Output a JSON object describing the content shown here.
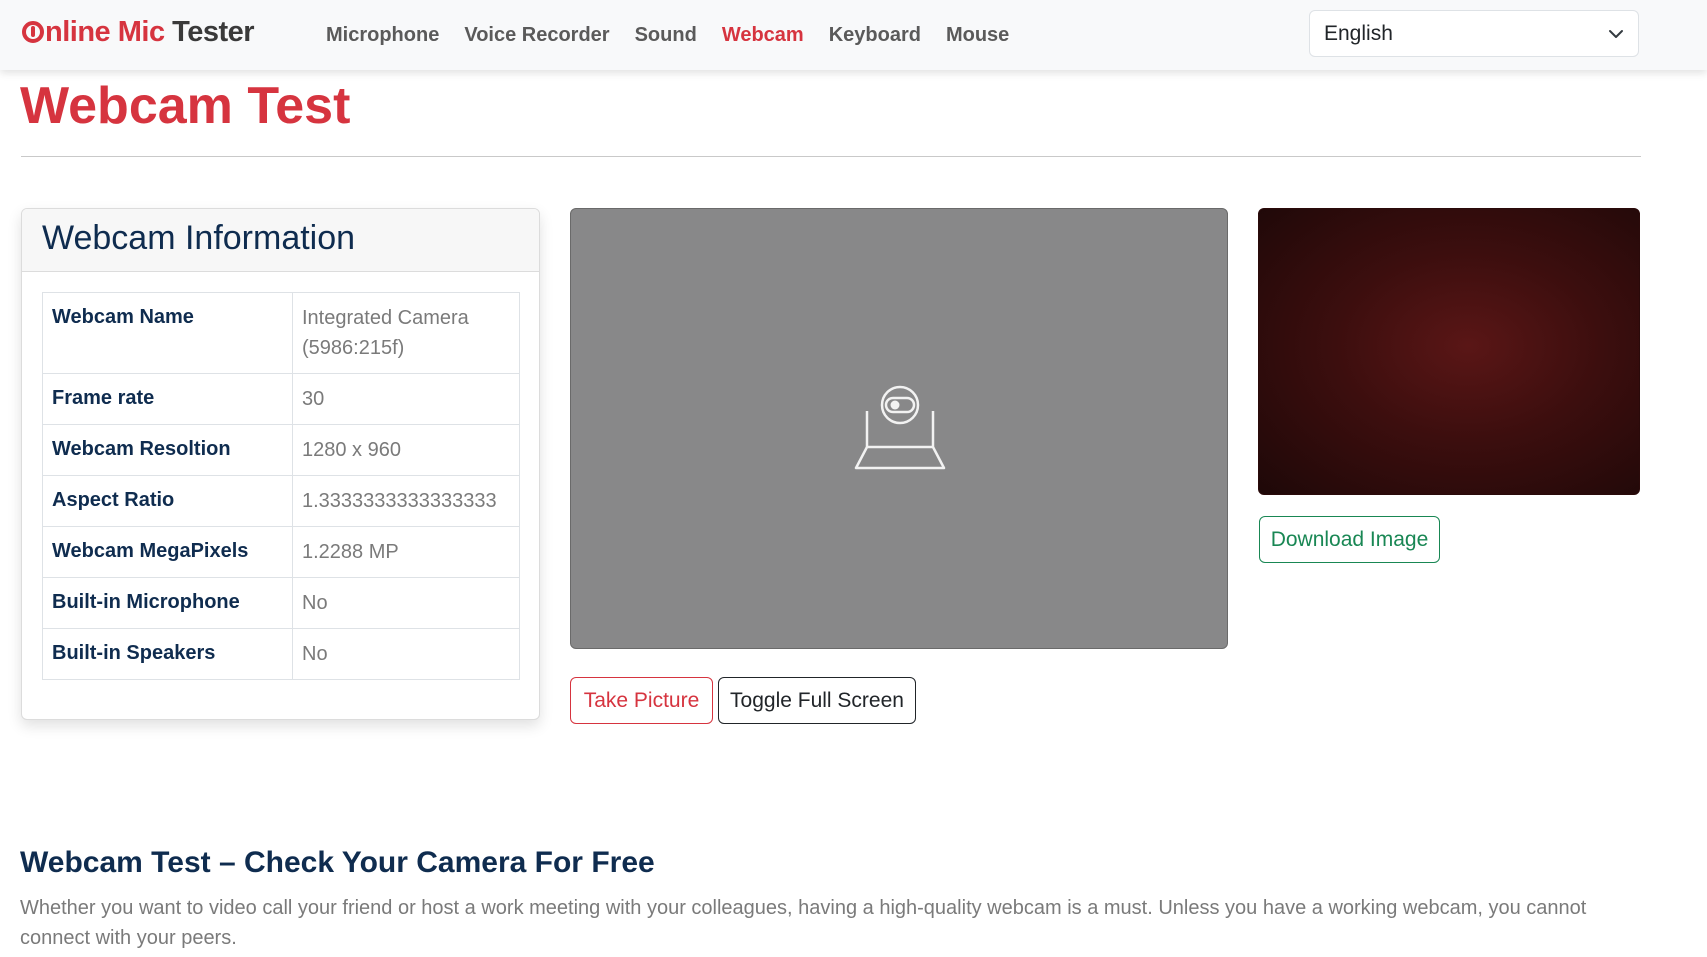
{
  "brand": {
    "logo_red": "nline Mic",
    "logo_dark": "Tester"
  },
  "nav": {
    "items": [
      {
        "label": "Microphone",
        "active": false
      },
      {
        "label": "Voice Recorder",
        "active": false
      },
      {
        "label": "Sound",
        "active": false
      },
      {
        "label": "Webcam",
        "active": true
      },
      {
        "label": "Keyboard",
        "active": false
      },
      {
        "label": "Mouse",
        "active": false
      }
    ],
    "language": "English"
  },
  "page": {
    "title": "Webcam Test"
  },
  "info": {
    "title": "Webcam Information",
    "rows": [
      {
        "label": "Webcam Name",
        "value": "Integrated Camera (5986:215f)"
      },
      {
        "label": "Frame rate",
        "value": "30"
      },
      {
        "label": "Webcam Resoltion",
        "value": "1280 x 960"
      },
      {
        "label": "Aspect Ratio",
        "value": "1.3333333333333333"
      },
      {
        "label": "Webcam MegaPixels",
        "value": "1.2288 MP"
      },
      {
        "label": "Built-in Microphone",
        "value": "No"
      },
      {
        "label": "Built-in Speakers",
        "value": "No"
      }
    ]
  },
  "video": {
    "placeholder_icon": "webcam-icon"
  },
  "buttons": {
    "take_picture": "Take Picture",
    "toggle_full_screen": "Toggle Full Screen",
    "download_image": "Download Image"
  },
  "article": {
    "heading": "Webcam Test – Check Your Camera For Free",
    "text": "Whether you want to video call your friend or host a work meeting with your colleagues, having a high-quality webcam is a must. Unless you have a working webcam, you cannot connect with your peers."
  },
  "colors": {
    "brand_red": "#d6343f",
    "navy": "#0f2c4f",
    "green": "#198754",
    "video_bg": "#888889"
  }
}
